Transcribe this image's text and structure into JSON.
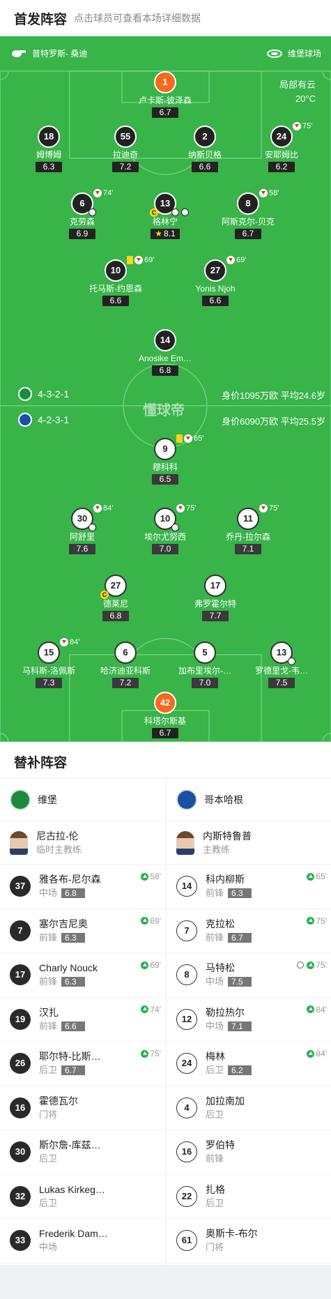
{
  "header": {
    "title": "首发阵容",
    "subtitle": "点击球员可查看本场详细数据"
  },
  "match": {
    "referee": "普特罗斯- 桑迪",
    "venue": "维堡球场",
    "weather": "局部有云",
    "temperature": "20°C"
  },
  "home": {
    "formation": "4-3-2-1",
    "value": "身价1095万欧 平均24.6岁",
    "players": [
      {
        "num": "1",
        "name": "卢卡斯-彼泽森",
        "rating": "6.7",
        "gk": true
      },
      {
        "num": "18",
        "name": "姆博姆",
        "rating": "6.3"
      },
      {
        "num": "55",
        "name": "拉迪奇",
        "rating": "7.2"
      },
      {
        "num": "2",
        "name": "纳斯贝格",
        "rating": "6.6"
      },
      {
        "num": "24",
        "name": "安耶姆比",
        "rating": "6.2",
        "sub": "75'"
      },
      {
        "num": "6",
        "name": "克劳森",
        "rating": "6.9",
        "sub": "74'"
      },
      {
        "num": "13",
        "name": "格林宁",
        "rating": "8.1",
        "mvp": true
      },
      {
        "num": "8",
        "name": "阿斯克尔-贝克",
        "rating": "6.7",
        "sub": "58'"
      },
      {
        "num": "10",
        "name": "托马斯-约恩森",
        "rating": "6.6",
        "sub": "69'"
      },
      {
        "num": "27",
        "name": "Yonis Njoh",
        "rating": "6.6",
        "sub": "69'"
      },
      {
        "num": "14",
        "name": "Anosike Em…",
        "rating": "6.8"
      }
    ]
  },
  "away": {
    "formation": "4-2-3-1",
    "value": "身价6090万欧 平均25.5岁",
    "players": [
      {
        "num": "9",
        "name": "穆科科",
        "rating": "6.5",
        "sub": "65'"
      },
      {
        "num": "30",
        "name": "阿舒里",
        "rating": "7.6",
        "sub": "84'"
      },
      {
        "num": "10",
        "name": "埃尔尤努西",
        "rating": "7.0",
        "sub": "75'"
      },
      {
        "num": "11",
        "name": "乔丹-拉尔森",
        "rating": "7.1",
        "sub": "75'"
      },
      {
        "num": "27",
        "name": "德莱尼",
        "rating": "6.8"
      },
      {
        "num": "17",
        "name": "弗罗霍尔特",
        "rating": "7.7"
      },
      {
        "num": "15",
        "name": "马科斯-洛佩斯",
        "rating": "7.3",
        "sub": "84'"
      },
      {
        "num": "6",
        "name": "哈济迪亚科斯",
        "rating": "7.2"
      },
      {
        "num": "5",
        "name": "加布里埃尔-…",
        "rating": "7.0"
      },
      {
        "num": "13",
        "name": "罗德里戈-韦…",
        "rating": "7.5"
      },
      {
        "num": "42",
        "name": "科塔尔斯基",
        "rating": "6.7",
        "gk": true
      }
    ]
  },
  "watermark": "懂球帝",
  "bench": {
    "title": "替补阵容",
    "home": {
      "team": "维堡",
      "coach": {
        "name": "尼古拉-伦",
        "role": "临时主教练"
      },
      "players": [
        {
          "num": "37",
          "name": "雅各布-尼尔森",
          "pos": "中场",
          "rating": "6.8",
          "in": "58'"
        },
        {
          "num": "7",
          "name": "塞尔吉尼奥",
          "pos": "前锋",
          "rating": "6.3",
          "in": "69'"
        },
        {
          "num": "17",
          "name": "Charly Nouck",
          "pos": "前锋",
          "rating": "6.3",
          "in": "69'"
        },
        {
          "num": "19",
          "name": "汉扎",
          "pos": "前锋",
          "rating": "6.6",
          "in": "74'"
        },
        {
          "num": "26",
          "name": "耶尔特-比斯…",
          "pos": "后卫",
          "rating": "6.7",
          "in": "75'"
        },
        {
          "num": "16",
          "name": "霍德瓦尔",
          "pos": "门将"
        },
        {
          "num": "30",
          "name": "斯尔詹-库兹…",
          "pos": "后卫"
        },
        {
          "num": "32",
          "name": "Lukas Kirkeg…",
          "pos": "后卫"
        },
        {
          "num": "33",
          "name": "Frederik Dam…",
          "pos": "中场"
        }
      ]
    },
    "away": {
      "team": "哥本哈根",
      "coach": {
        "name": "内斯特鲁普",
        "role": "主教练"
      },
      "players": [
        {
          "num": "14",
          "name": "科内柳斯",
          "pos": "前锋",
          "rating": "6.3",
          "in": "65'"
        },
        {
          "num": "7",
          "name": "克拉松",
          "pos": "前锋",
          "rating": "6.7",
          "in": "75'"
        },
        {
          "num": "8",
          "name": "马特松",
          "pos": "中场",
          "rating": "7.5",
          "in": "75'"
        },
        {
          "num": "12",
          "name": "勒拉热尔",
          "pos": "中场",
          "rating": "7.1",
          "in": "84'"
        },
        {
          "num": "24",
          "name": "梅林",
          "pos": "后卫",
          "rating": "6.2",
          "in": "84'"
        },
        {
          "num": "4",
          "name": "加拉南加",
          "pos": "后卫"
        },
        {
          "num": "16",
          "name": "罗伯特",
          "pos": "前锋"
        },
        {
          "num": "22",
          "name": "扎格",
          "pos": "后卫"
        },
        {
          "num": "61",
          "name": "奥斯卡-布尔",
          "pos": "门将"
        }
      ]
    }
  }
}
